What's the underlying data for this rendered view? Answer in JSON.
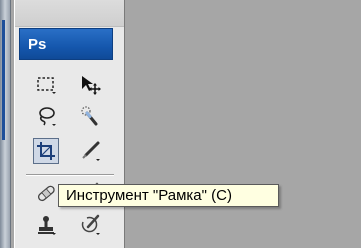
{
  "app": {
    "logo_text": "Ps"
  },
  "tooltip": {
    "text": "Инструмент \"Рамка\" (C)"
  },
  "tools": [
    {
      "name": "rectangular-marquee-tool"
    },
    {
      "name": "move-tool"
    },
    {
      "name": "lasso-tool"
    },
    {
      "name": "quick-selection-tool"
    },
    {
      "name": "crop-tool",
      "selected": true
    },
    {
      "name": "slice-tool"
    },
    {
      "name": "spot-healing-brush-tool"
    },
    {
      "name": "brush-tool"
    },
    {
      "name": "clone-stamp-tool"
    },
    {
      "name": "history-brush-tool"
    }
  ],
  "colors": {
    "brand": "#1557ad",
    "tooltip_bg": "#ffffe1",
    "canvas_bg": "#a6a6a6"
  }
}
